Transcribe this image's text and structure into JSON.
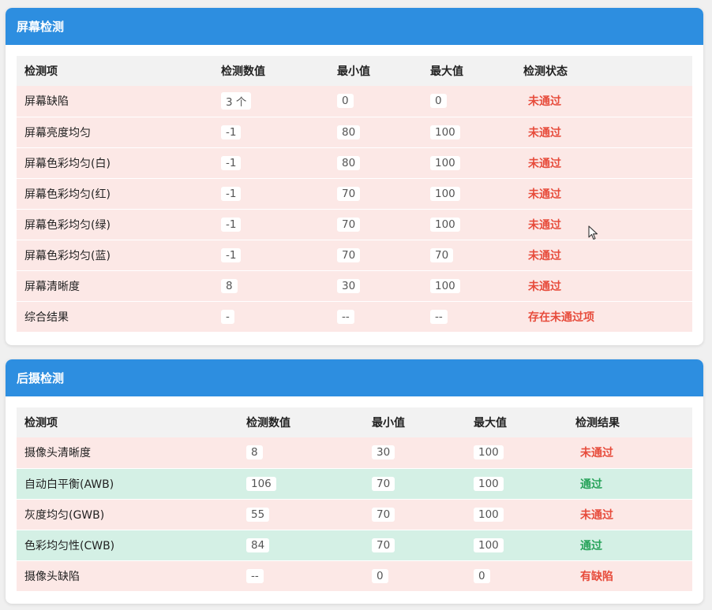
{
  "screen_test": {
    "title": "屏幕检测",
    "headers": [
      "检测项",
      "检测数值",
      "最小值",
      "最大值",
      "检测状态"
    ],
    "rows": [
      {
        "item": "屏幕缺陷",
        "value": "3 个",
        "min": "0",
        "max": "0",
        "status": "未通过",
        "result": "fail"
      },
      {
        "item": "屏幕亮度均匀",
        "value": "-1",
        "min": "80",
        "max": "100",
        "status": "未通过",
        "result": "fail"
      },
      {
        "item": "屏幕色彩均匀(白)",
        "value": "-1",
        "min": "80",
        "max": "100",
        "status": "未通过",
        "result": "fail"
      },
      {
        "item": "屏幕色彩均匀(红)",
        "value": "-1",
        "min": "70",
        "max": "100",
        "status": "未通过",
        "result": "fail"
      },
      {
        "item": "屏幕色彩均匀(绿)",
        "value": "-1",
        "min": "70",
        "max": "100",
        "status": "未通过",
        "result": "fail"
      },
      {
        "item": "屏幕色彩均匀(蓝)",
        "value": "-1",
        "min": "70",
        "max": "70",
        "status": "未通过",
        "result": "fail"
      },
      {
        "item": "屏幕清晰度",
        "value": "8",
        "min": "30",
        "max": "100",
        "status": "未通过",
        "result": "fail"
      },
      {
        "item": "综合结果",
        "value": "-",
        "min": "--",
        "max": "--",
        "status": "存在未通过项",
        "result": "fail"
      }
    ]
  },
  "rear_camera_test": {
    "title": "后摄检测",
    "headers": [
      "检测项",
      "检测数值",
      "最小值",
      "最大值",
      "检测结果"
    ],
    "rows": [
      {
        "item": "摄像头清晰度",
        "value": "8",
        "min": "30",
        "max": "100",
        "status": "未通过",
        "result": "fail"
      },
      {
        "item": "自动白平衡(AWB)",
        "value": "106",
        "min": "70",
        "max": "100",
        "status": "通过",
        "result": "pass"
      },
      {
        "item": "灰度均匀(GWB)",
        "value": "55",
        "min": "70",
        "max": "100",
        "status": "未通过",
        "result": "fail"
      },
      {
        "item": "色彩均匀性(CWB)",
        "value": "84",
        "min": "70",
        "max": "100",
        "status": "通过",
        "result": "pass"
      },
      {
        "item": "摄像头缺陷",
        "value": "--",
        "min": "0",
        "max": "0",
        "status": "有缺陷",
        "result": "fail"
      }
    ]
  },
  "colors": {
    "header_blue": "#2d8ee0",
    "fail_row": "#fce8e6",
    "pass_row": "#d4f0e5",
    "fail_text": "#e74c3c",
    "pass_text": "#27a35a"
  }
}
